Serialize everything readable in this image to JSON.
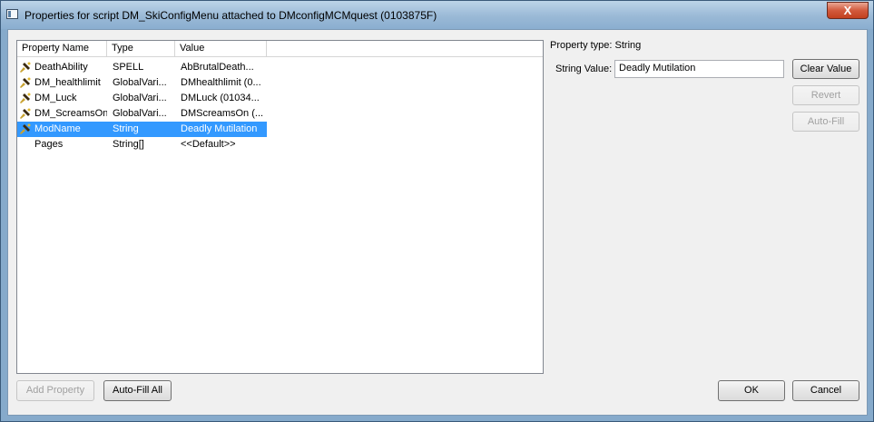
{
  "window": {
    "title": "Properties for script DM_SkiConfigMenu attached to DMconfigMCMquest (0103875F)",
    "close_label": "X"
  },
  "property_list": {
    "columns": [
      "Property Name",
      "Type",
      "Value"
    ],
    "rows": [
      {
        "name": "DeathAbility",
        "type": "SPELL",
        "value": "AbBrutalDeath...",
        "icon": "hammer-icon",
        "selected": false
      },
      {
        "name": "DM_healthlimit",
        "type": "GlobalVari...",
        "value": "DMhealthlimit (0...",
        "icon": "hammer-icon",
        "selected": false
      },
      {
        "name": "DM_Luck",
        "type": "GlobalVari...",
        "value": "DMLuck (01034...",
        "icon": "hammer-icon",
        "selected": false
      },
      {
        "name": "DM_ScreamsOn",
        "type": "GlobalVari...",
        "value": "DMScreamsOn (...",
        "icon": "hammer-icon",
        "selected": false
      },
      {
        "name": "ModName",
        "type": "String",
        "value": "Deadly Mutilation",
        "icon": "hammer-icon",
        "selected": true
      },
      {
        "name": "Pages",
        "type": "String[]",
        "value": "<<Default>>",
        "icon": "",
        "selected": false
      }
    ]
  },
  "detail": {
    "property_type_label": "Property type: String",
    "string_value_label": "String Value:",
    "string_value": "Deadly Mutilation",
    "clear_value_label": "Clear Value",
    "revert_label": "Revert",
    "auto_fill_label": "Auto-Fill"
  },
  "footer": {
    "add_property_label": "Add Property",
    "auto_fill_all_label": "Auto-Fill All",
    "ok_label": "OK",
    "cancel_label": "Cancel"
  },
  "colors": {
    "selection": "#3399ff",
    "titlebar": "#9ab9d6",
    "close_button": "#c94a2c"
  }
}
